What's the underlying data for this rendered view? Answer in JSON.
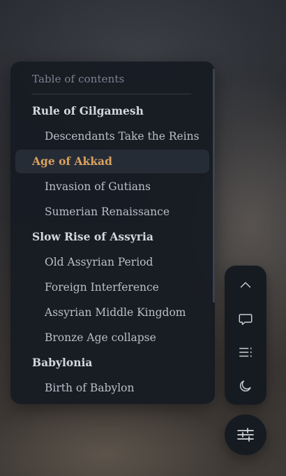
{
  "toc": {
    "title": "Table of contents",
    "items": [
      {
        "label": "Rule of Gilgamesh",
        "level": 1,
        "active": false
      },
      {
        "label": "Descendants Take the Reins",
        "level": 2,
        "active": false
      },
      {
        "label": "Age of Akkad",
        "level": 1,
        "active": true
      },
      {
        "label": "Invasion of Gutians",
        "level": 2,
        "active": false
      },
      {
        "label": "Sumerian Renaissance",
        "level": 2,
        "active": false
      },
      {
        "label": "Slow Rise of Assyria",
        "level": 1,
        "active": false
      },
      {
        "label": "Old Assyrian Period",
        "level": 2,
        "active": false
      },
      {
        "label": "Foreign Interference",
        "level": 2,
        "active": false
      },
      {
        "label": "Assyrian Middle Kingdom",
        "level": 2,
        "active": false
      },
      {
        "label": "Bronze Age collapse",
        "level": 2,
        "active": false
      },
      {
        "label": "Babylonia",
        "level": 1,
        "active": false
      },
      {
        "label": "Birth of Babylon",
        "level": 2,
        "active": false
      }
    ]
  },
  "actions": [
    {
      "name": "scroll-to-top-button",
      "icon": "chevron-up-icon"
    },
    {
      "name": "comments-button",
      "icon": "speech-bubble-icon"
    },
    {
      "name": "table-of-contents-button",
      "icon": "list-icon"
    },
    {
      "name": "dark-mode-toggle",
      "icon": "moon-icon"
    }
  ],
  "fab": {
    "icon": "sliders-icon"
  },
  "colors": {
    "panel": "#161b22",
    "active_text": "#d9a25f",
    "heading_text": "#d3d8df",
    "sub_text": "#b9c0ca",
    "muted_text": "#7b8390"
  }
}
